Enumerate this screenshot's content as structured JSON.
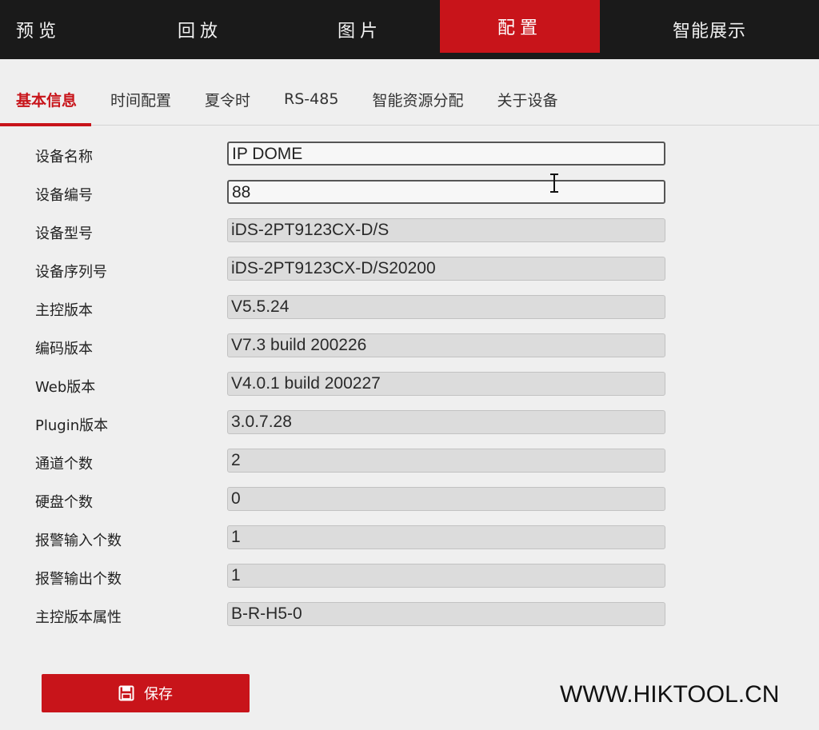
{
  "topnav": {
    "items": [
      {
        "label": "预览"
      },
      {
        "label": "回放"
      },
      {
        "label": "图片"
      },
      {
        "label": "配置"
      },
      {
        "label": "智能展示"
      }
    ],
    "active_index": 3,
    "active_color": "#c8141a"
  },
  "subtabs": {
    "items": [
      {
        "label": "基本信息"
      },
      {
        "label": "时间配置"
      },
      {
        "label": "夏令时"
      },
      {
        "label": "RS-485"
      },
      {
        "label": "智能资源分配"
      },
      {
        "label": "关于设备"
      }
    ],
    "active_index": 0
  },
  "form": {
    "fields": [
      {
        "label": "设备名称",
        "value": "IP DOME",
        "editable": true
      },
      {
        "label": "设备编号",
        "value": "88",
        "editable": true
      },
      {
        "label": "设备型号",
        "value": "iDS-2PT9123CX-D/S",
        "editable": false
      },
      {
        "label": "设备序列号",
        "value": "iDS-2PT9123CX-D/S20200",
        "editable": false
      },
      {
        "label": "主控版本",
        "value": "V5.5.24",
        "editable": false
      },
      {
        "label": "编码版本",
        "value": "V7.3 build 200226",
        "editable": false
      },
      {
        "label": "Web版本",
        "value": "V4.0.1 build 200227",
        "editable": false
      },
      {
        "label": "Plugin版本",
        "value": "3.0.7.28",
        "editable": false
      },
      {
        "label": "通道个数",
        "value": "2",
        "editable": false
      },
      {
        "label": "硬盘个数",
        "value": "0",
        "editable": false
      },
      {
        "label": "报警输入个数",
        "value": "1",
        "editable": false
      },
      {
        "label": "报警输出个数",
        "value": "1",
        "editable": false
      },
      {
        "label": "主控版本属性",
        "value": "B-R-H5-0",
        "editable": false
      }
    ]
  },
  "actions": {
    "save_label": "保存",
    "save_icon": "save-icon"
  },
  "watermark": "WWW.HIKTOOL.CN",
  "colors": {
    "accent": "#c8141a",
    "nav_background": "#1a1a1a",
    "page_background": "#efefef"
  }
}
